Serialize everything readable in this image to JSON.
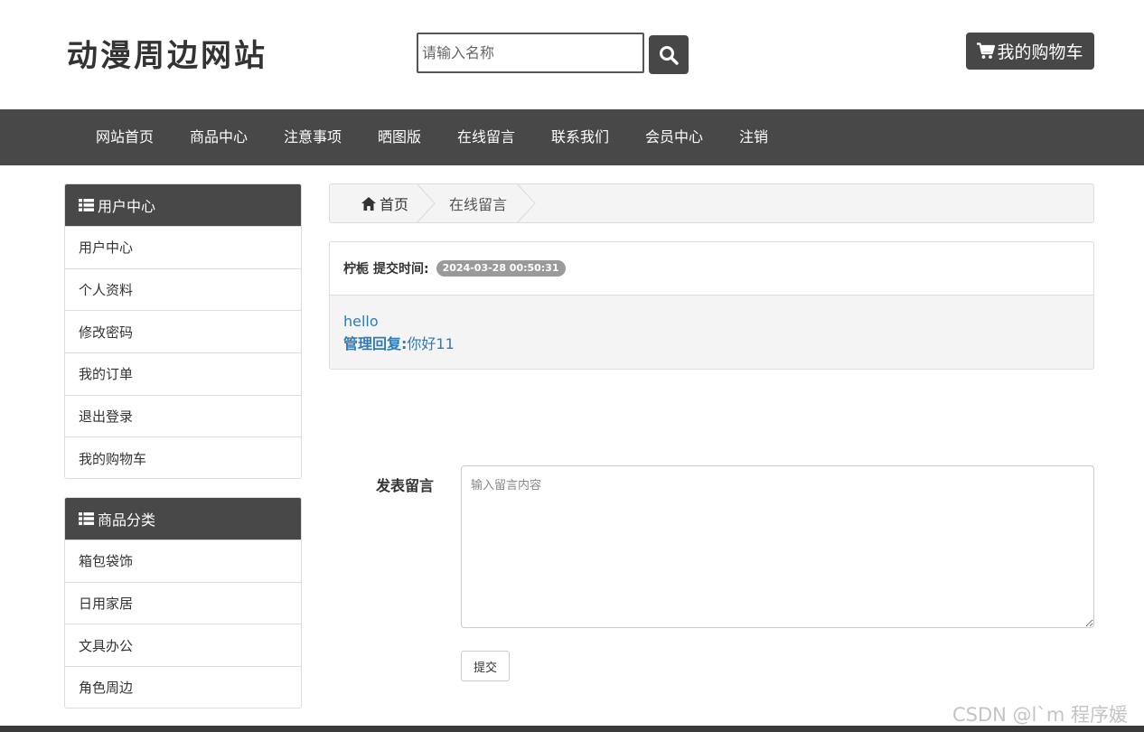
{
  "header": {
    "site_title": "动漫周边网站",
    "search_placeholder": "请输入名称",
    "search_icon": "search-icon",
    "cart_label": "我的购物车",
    "cart_icon": "shopping-cart-icon"
  },
  "nav": {
    "items": [
      "网站首页",
      "商品中心",
      "注意事项",
      "晒图版",
      "在线留言",
      "联系我们",
      "会员中心",
      "注销"
    ]
  },
  "sidebar": {
    "user_center": {
      "title": "用户中心",
      "icon": "list-icon",
      "items": [
        "用户中心",
        "个人资料",
        "修改密码",
        "我的订单",
        "退出登录",
        "我的购物车"
      ]
    },
    "categories": {
      "title": "商品分类",
      "icon": "list-icon",
      "items": [
        "箱包袋饰",
        "日用家居",
        "文具办公",
        "角色周边"
      ]
    }
  },
  "breadcrumb": {
    "home_icon": "home-icon",
    "home": "首页",
    "current": "在线留言"
  },
  "message": {
    "author": "柠栀",
    "time_label": "提交时间:",
    "time": "2024-03-28 00:50:31",
    "content": "hello",
    "reply_label": "管理回复:",
    "reply": "你好11"
  },
  "form": {
    "label": "发表留言",
    "placeholder": "输入留言内容",
    "submit": "提交"
  },
  "watermark": "CSDN @l`m 程序媛",
  "colors": {
    "dark": "#484848",
    "link": "#337ab7",
    "badge": "#9a9a9a"
  }
}
